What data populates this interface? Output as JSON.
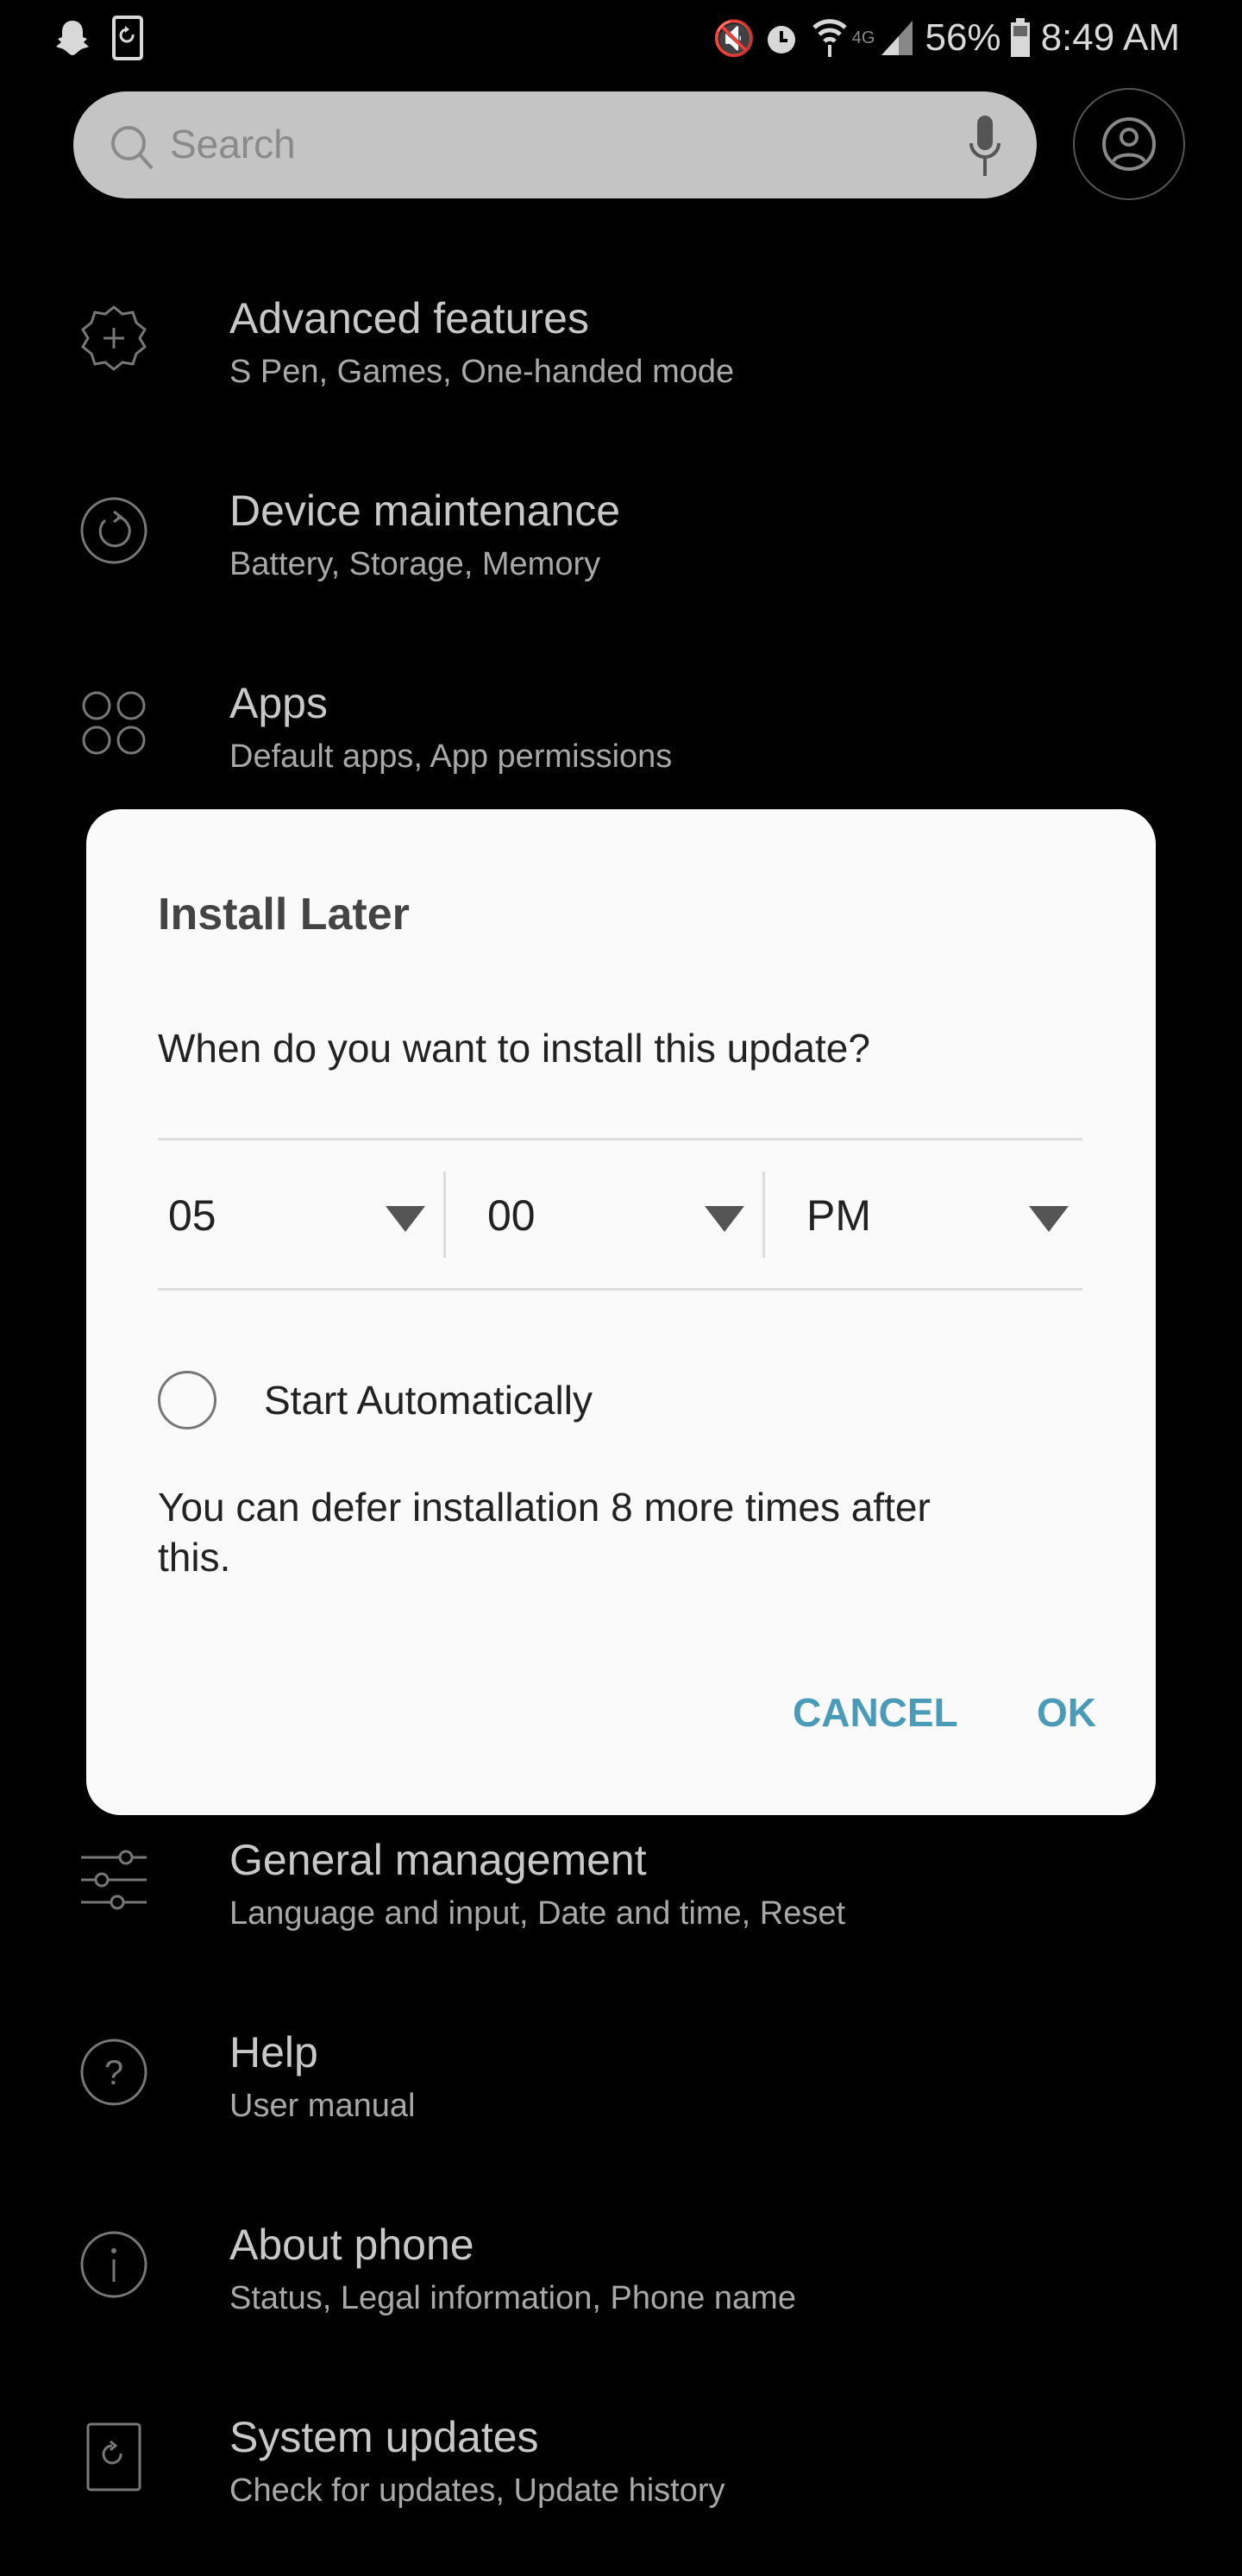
{
  "status_bar": {
    "left_icons": [
      "snapchat-icon",
      "screen-rotate-icon"
    ],
    "right_icons": [
      "mute-vibrate-icon",
      "alarm-icon",
      "wifi-icon",
      "lte-off-icon",
      "signal-icon"
    ],
    "battery": "56%",
    "time": "8:49 AM"
  },
  "search": {
    "placeholder": "Search",
    "icons": [
      "search-icon",
      "mic-icon"
    ]
  },
  "profile_icon": "account-circle-icon",
  "settings": [
    {
      "icon": "plus-gear-icon",
      "title": "Advanced features",
      "subtitle": "S Pen, Games, One-handed mode"
    },
    {
      "icon": "refresh-circle-icon",
      "title": "Device maintenance",
      "subtitle": "Battery, Storage, Memory"
    },
    {
      "icon": "apps-grid-icon",
      "title": "Apps",
      "subtitle": "Default apps, App permissions"
    },
    {
      "icon": "sliders-icon",
      "title": "General management",
      "subtitle": "Language and input, Date and time, Reset"
    },
    {
      "icon": "help-circle-icon",
      "title": "Help",
      "subtitle": "User manual"
    },
    {
      "icon": "info-circle-icon",
      "title": "About phone",
      "subtitle": "Status, Legal information, Phone name"
    },
    {
      "icon": "system-update-icon",
      "title": "System updates",
      "subtitle": "Check for updates, Update history"
    }
  ],
  "dialog": {
    "title": "Install Later",
    "question": "When do you want to install this update?",
    "hour": "05",
    "minute": "00",
    "ampm": "PM",
    "start_auto_label": "Start Automatically",
    "start_auto_checked": false,
    "defer_text": "You can defer installation 8 more times after this.",
    "cancel": "CANCEL",
    "ok": "OK",
    "accent": "#4a9bb8"
  }
}
